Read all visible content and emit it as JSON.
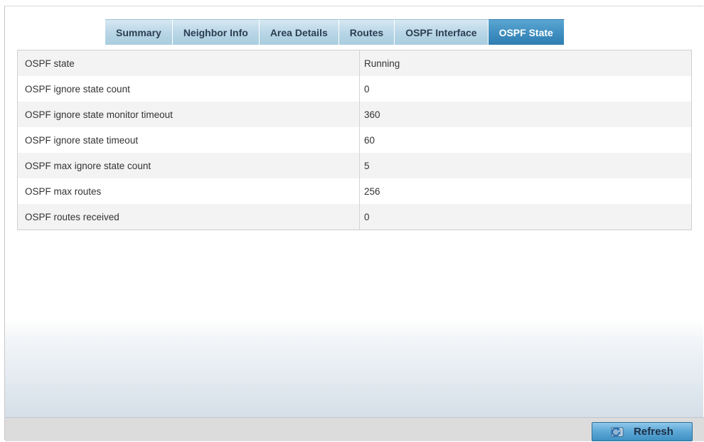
{
  "tabs": [
    {
      "label": "Summary",
      "active": false
    },
    {
      "label": "Neighbor Info",
      "active": false
    },
    {
      "label": "Area Details",
      "active": false
    },
    {
      "label": "Routes",
      "active": false
    },
    {
      "label": "OSPF Interface",
      "active": false
    },
    {
      "label": "OSPF State",
      "active": true
    }
  ],
  "rows": [
    {
      "label": "OSPF state",
      "value": "Running"
    },
    {
      "label": "OSPF ignore state count",
      "value": "0"
    },
    {
      "label": "OSPF ignore state monitor timeout",
      "value": "360"
    },
    {
      "label": "OSPF ignore state timeout",
      "value": "60"
    },
    {
      "label": "OSPF max ignore state count",
      "value": "5"
    },
    {
      "label": "OSPF max routes",
      "value": "256"
    },
    {
      "label": "OSPF routes received",
      "value": "0"
    }
  ],
  "footer": {
    "refresh_label": "Refresh",
    "refresh_icon": "refresh-icon"
  },
  "colors": {
    "active_tab": "#3f8ec0",
    "inactive_tab": "#b7d5e5",
    "button": "#5ba7d6"
  }
}
